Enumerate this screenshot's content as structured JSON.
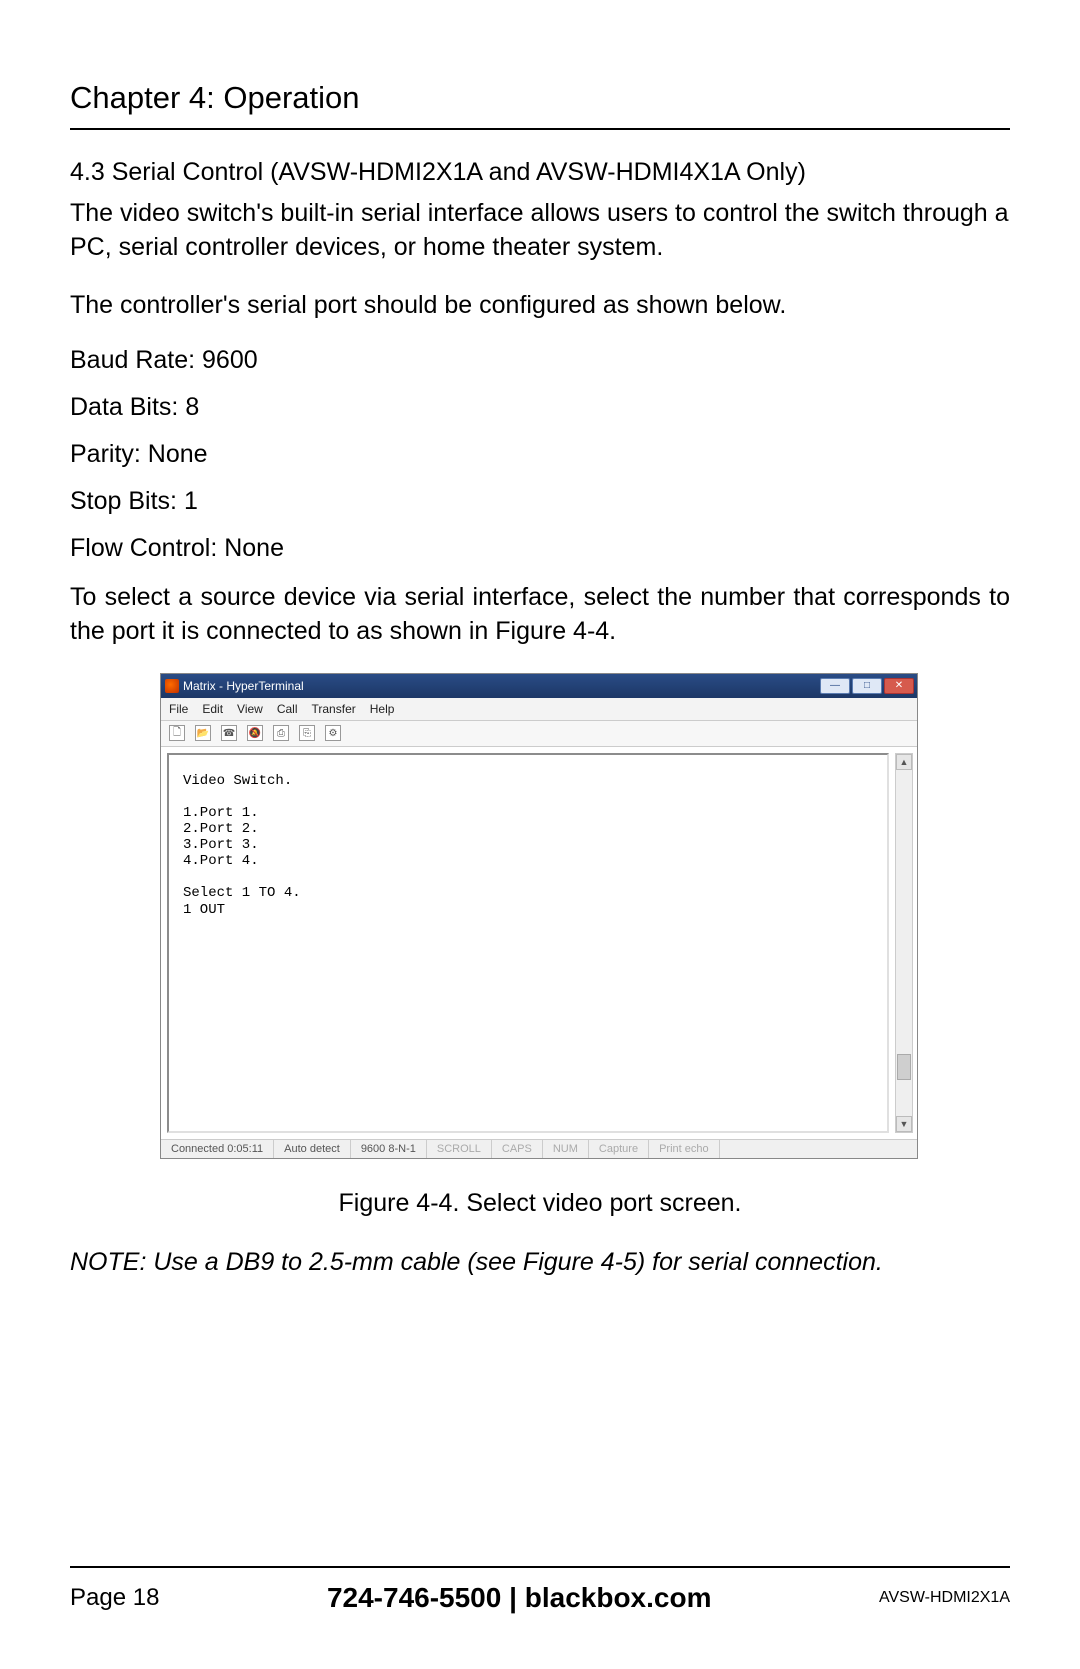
{
  "chapter_title": "Chapter 4: Operation",
  "section_title": "4.3 Serial Control (AVSW-HDMI2X1A and AVSW-HDMI4X1A Only)",
  "intro_p1": "The video switch's built-in serial interface allows users to control the switch through a PC, serial controller devices, or home theater system.",
  "intro_p2": "The controller's serial port should be configured as shown below.",
  "settings": {
    "baud": "Baud Rate: 9600",
    "data_bits": "Data Bits: 8",
    "parity": "Parity: None",
    "stop_bits": "Stop Bits: 1",
    "flow": "Flow Control: None"
  },
  "instruction": "To select a source device via serial interface, select the number that corresponds to the port it is connected to as shown in Figure 4-4.",
  "hyperterminal": {
    "title": "Matrix - HyperTerminal",
    "menu": {
      "file": "File",
      "edit": "Edit",
      "view": "View",
      "call": "Call",
      "transfer": "Transfer",
      "help": "Help"
    },
    "terminal_text": "Video Switch.\n\n1.Port 1.\n2.Port 2.\n3.Port 3.\n4.Port 4.\n\nSelect 1 TO 4.\n1 OUT",
    "status": {
      "connected": "Connected 0:05:11",
      "auto_detect": "Auto detect",
      "mode": "9600 8-N-1",
      "scroll": "SCROLL",
      "caps": "CAPS",
      "num": "NUM",
      "capture": "Capture",
      "print_echo": "Print echo"
    }
  },
  "figure_caption": "Figure 4-4. Select video port screen.",
  "note": "NOTE: Use a DB9 to 2.5-mm cable (see Figure 4-5) for serial connection.",
  "footer": {
    "page": "Page 18",
    "phone": "724-746-5500",
    "sep": "  |  ",
    "site": "blackbox.com",
    "model": "AVSW-HDMI2X1A"
  }
}
